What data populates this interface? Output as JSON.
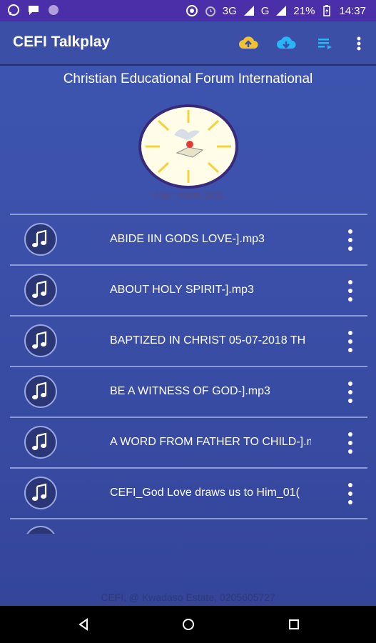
{
  "status_bar": {
    "network": "3G",
    "network_sup": "3G",
    "carrier": "G",
    "battery": "21%",
    "time": "14:37"
  },
  "app_bar": {
    "title": "CEFI Talkplay",
    "upload_icon": "cloud-upload-icon",
    "download_icon": "cloud-download-icon",
    "playlist_icon": "playlist-icon",
    "overflow_icon": "more-vert-icon",
    "upload_color": "#f2c230",
    "download_color": "#29b6f6",
    "playlist_color": "#29b6f6"
  },
  "header": {
    "organization": "Christian Educational Forum International",
    "vision": "Vision: Matth 28:20"
  },
  "tracks": [
    {
      "label": "ABIDE IIN GODS LOVE-].mp3"
    },
    {
      "label": "ABOUT HOLY SPIRIT-].mp3"
    },
    {
      "label": "BAPTIZED IN CHRIST 05-07-2018 TH"
    },
    {
      "label": "BE A WITNESS OF GOD-].mp3"
    },
    {
      "label": "A WORD FROM FATHER TO CHILD-].m"
    },
    {
      "label": "CEFI_God Love draws us to Him_01("
    }
  ],
  "footer": {
    "text": "CEFI, @ Kwadaso Estate, 0205605727"
  }
}
